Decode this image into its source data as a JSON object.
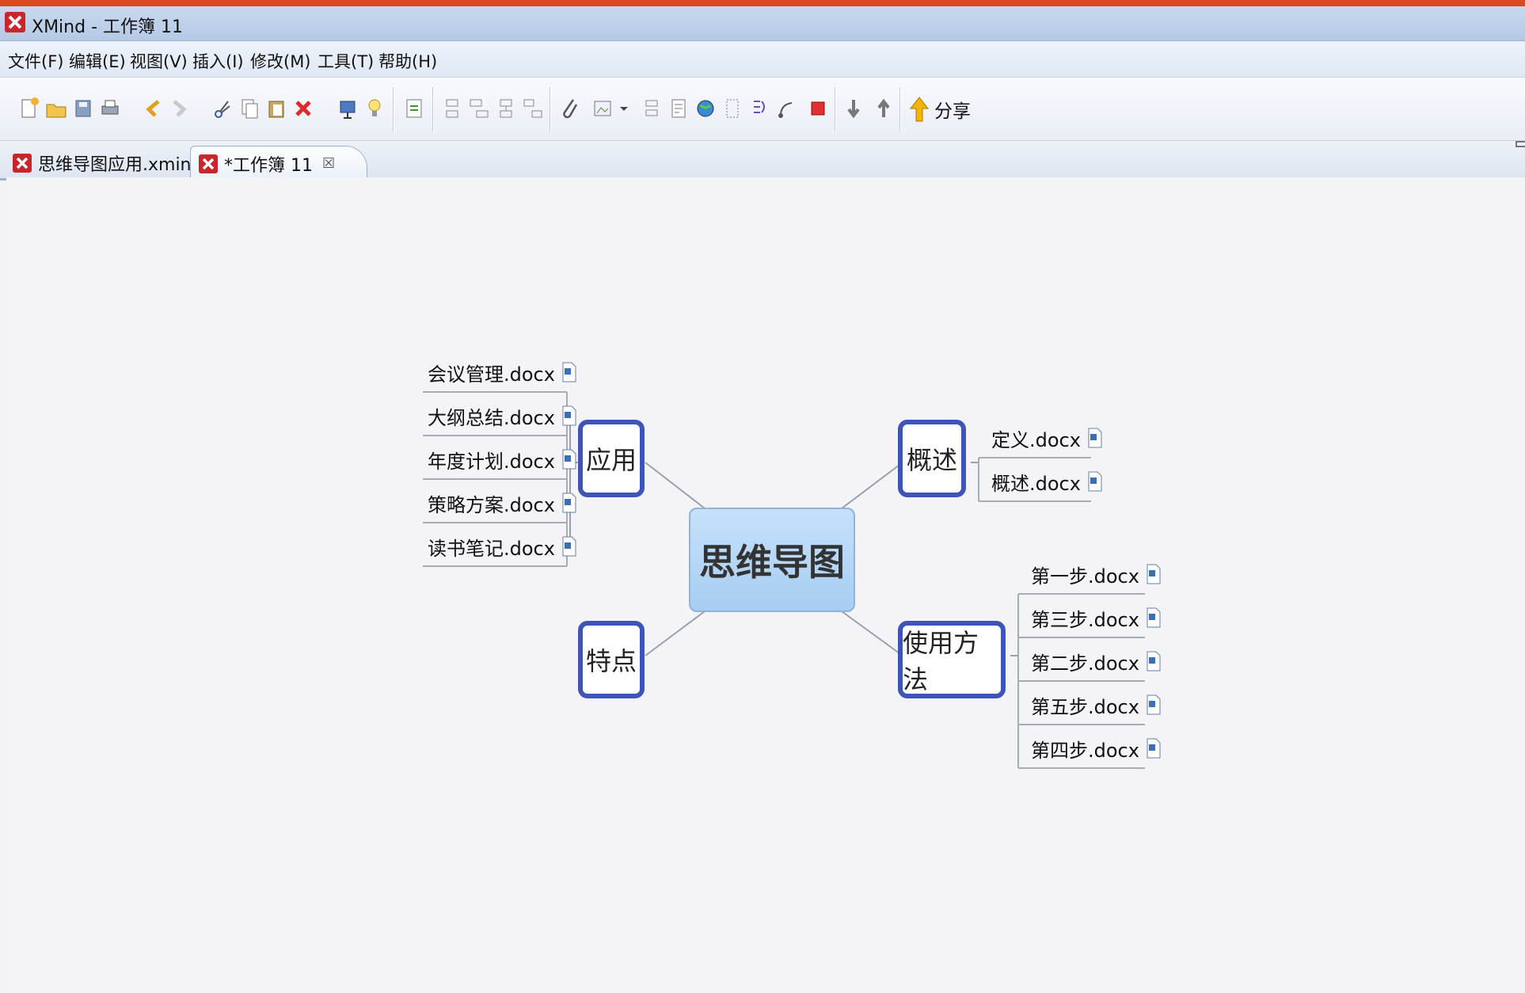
{
  "window": {
    "title": "XMind - 工作簿 11"
  },
  "menu": [
    "文件(F)",
    "编辑(E)",
    "视图(V)",
    "插入(I)",
    "修改(M)",
    "工具(T)",
    "帮助(H)"
  ],
  "toolbar": {
    "share_label": "分享"
  },
  "tabs": [
    {
      "label": "思维导图应用.xmind",
      "active": false
    },
    {
      "label": "*工作簿 11",
      "active": true,
      "close": "☒"
    }
  ],
  "map": {
    "central": "思维导图",
    "topics": {
      "yingyong": {
        "label": "应用",
        "children": [
          "会议管理.docx",
          "大纲总结.docx",
          "年度计划.docx",
          "策略方案.docx",
          "读书笔记.docx"
        ]
      },
      "gaishu": {
        "label": "概述",
        "children": [
          "定义.docx",
          "概述.docx"
        ]
      },
      "tedian": {
        "label": "特点",
        "children": []
      },
      "shiyong": {
        "label": "使用方法",
        "children": [
          "第一步.docx",
          "第三步.docx",
          "第二步.docx",
          "第五步.docx",
          "第四步.docx"
        ]
      }
    }
  },
  "colors": {
    "accent_border": "#3d55b8",
    "window_frame": "#d94a1f",
    "central_fill": "#b3d5f5"
  }
}
